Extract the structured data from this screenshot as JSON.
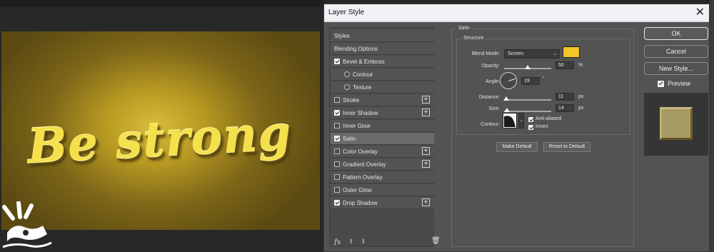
{
  "artwork": {
    "text": "Be strong"
  },
  "dialog": {
    "title": "Layer Style",
    "close_glyph": "✕",
    "styles_list": {
      "items": [
        {
          "label": "Styles",
          "checkbox": "none",
          "plus": false,
          "selected": false,
          "indent": 0
        },
        {
          "label": "Blending Options",
          "checkbox": "none",
          "plus": false,
          "selected": false,
          "indent": 0
        },
        {
          "label": "Bevel & Emboss",
          "checkbox": "checked",
          "plus": false,
          "selected": false,
          "indent": 0
        },
        {
          "label": "Contour",
          "checkbox": "unchecked-round",
          "plus": false,
          "selected": false,
          "indent": 1
        },
        {
          "label": "Texture",
          "checkbox": "unchecked-round",
          "plus": false,
          "selected": false,
          "indent": 1
        },
        {
          "label": "Stroke",
          "checkbox": "unchecked",
          "plus": true,
          "selected": false,
          "indent": 0
        },
        {
          "label": "Inner Shadow",
          "checkbox": "checked",
          "plus": true,
          "selected": false,
          "indent": 0
        },
        {
          "label": "Inner Glow",
          "checkbox": "unchecked",
          "plus": false,
          "selected": false,
          "indent": 0
        },
        {
          "label": "Satin",
          "checkbox": "checked",
          "plus": false,
          "selected": true,
          "indent": 0
        },
        {
          "label": "Color Overlay",
          "checkbox": "unchecked",
          "plus": true,
          "selected": false,
          "indent": 0
        },
        {
          "label": "Gradient Overlay",
          "checkbox": "unchecked",
          "plus": true,
          "selected": false,
          "indent": 0
        },
        {
          "label": "Pattern Overlay",
          "checkbox": "unchecked",
          "plus": false,
          "selected": false,
          "indent": 0
        },
        {
          "label": "Outer Glow",
          "checkbox": "unchecked",
          "plus": false,
          "selected": false,
          "indent": 0
        },
        {
          "label": "Drop Shadow",
          "checkbox": "checked",
          "plus": true,
          "selected": false,
          "indent": 0
        }
      ],
      "footer": {
        "fx": "fx",
        "up": "⬆",
        "down": "⬇",
        "trash": "🗑"
      }
    },
    "satin": {
      "section_title": "Satin",
      "structure_title": "Structure",
      "blend_mode": {
        "label": "Blend Mode:",
        "value": "Screen",
        "color": "#f3c62a"
      },
      "opacity": {
        "label": "Opacity:",
        "value": "50",
        "unit": "%",
        "level": 0.5
      },
      "angle": {
        "label": "Angle:",
        "value": "19",
        "unit": "°"
      },
      "distance": {
        "label": "Distance:",
        "value": "11",
        "unit": "px",
        "level": 0.05
      },
      "size": {
        "label": "Size:",
        "value": "14",
        "unit": "px",
        "level": 0.06
      },
      "contour": {
        "label": "Contour:"
      },
      "anti_aliased": {
        "label": "Anti-aliased",
        "checked": true
      },
      "invert": {
        "label": "Invert",
        "checked": true
      },
      "make_default": "Make Default",
      "reset_default": "Reset to Default"
    },
    "buttons": {
      "ok": "OK",
      "cancel": "Cancel",
      "new_style": "New Style..."
    },
    "preview": {
      "label": "Preview",
      "checked": true
    }
  }
}
